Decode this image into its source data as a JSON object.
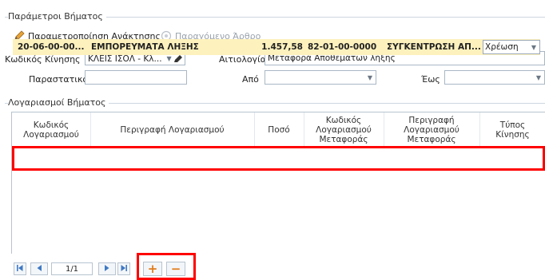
{
  "step_params": {
    "legend": "Παράμετροι Βήματος",
    "toolbar": {
      "param_label": "Παραμετροποίηση Ανάκτησης",
      "derived_label": "Παραγόμενο Άρθρο"
    },
    "movement_code_label": "Κωδικός Κίνησης",
    "movement_code_value": "ΚΛΕΙΣ ΙΣΟΛ - Κλ...",
    "reason_label": "Αιτιολογία",
    "reason_value": "Μεταφορά Αποθεμάτων λήξης",
    "document_label": "Παραστατικό",
    "document_value": "",
    "from_label": "Από",
    "from_value": "",
    "to_label": "Έως",
    "to_value": ""
  },
  "accounts": {
    "legend": "Λογαριασμοί Βήματος",
    "columns": [
      "Κωδικός\nΛογαριασμού",
      "Περιγραφή Λογαριασμού",
      "Ποσό",
      "Κωδικός\nΛογαριασμού\nΜεταφοράς",
      "Περιγραφή\nΛογαριασμού\nΜεταφοράς",
      "Τύπος\nΚίνησης"
    ],
    "rows": [
      {
        "code": "20-06-00-00...",
        "description": "ΕΜΠΟΡΕΥΜΑΤΑ ΛΗΞΗΣ",
        "amount": "1.457,58",
        "transfer_code": "82-01-00-0000",
        "transfer_description": "ΣΥΓΚΕΝΤΡΩΣΗ ΑΠ...",
        "movement_type": "Χρέωση"
      }
    ]
  },
  "pager": {
    "page": "1/1",
    "add_symbol": "+",
    "remove_symbol": "−"
  },
  "colors": {
    "highlight": "#ff0000",
    "selected_row": "#fdf1bd",
    "accent_blue": "#3f79c4"
  },
  "icons": [
    "pencil-icon",
    "derived-article-icon",
    "first-page-icon",
    "prev-page-icon",
    "next-page-icon",
    "last-page-icon",
    "chevron-down-icon"
  ]
}
